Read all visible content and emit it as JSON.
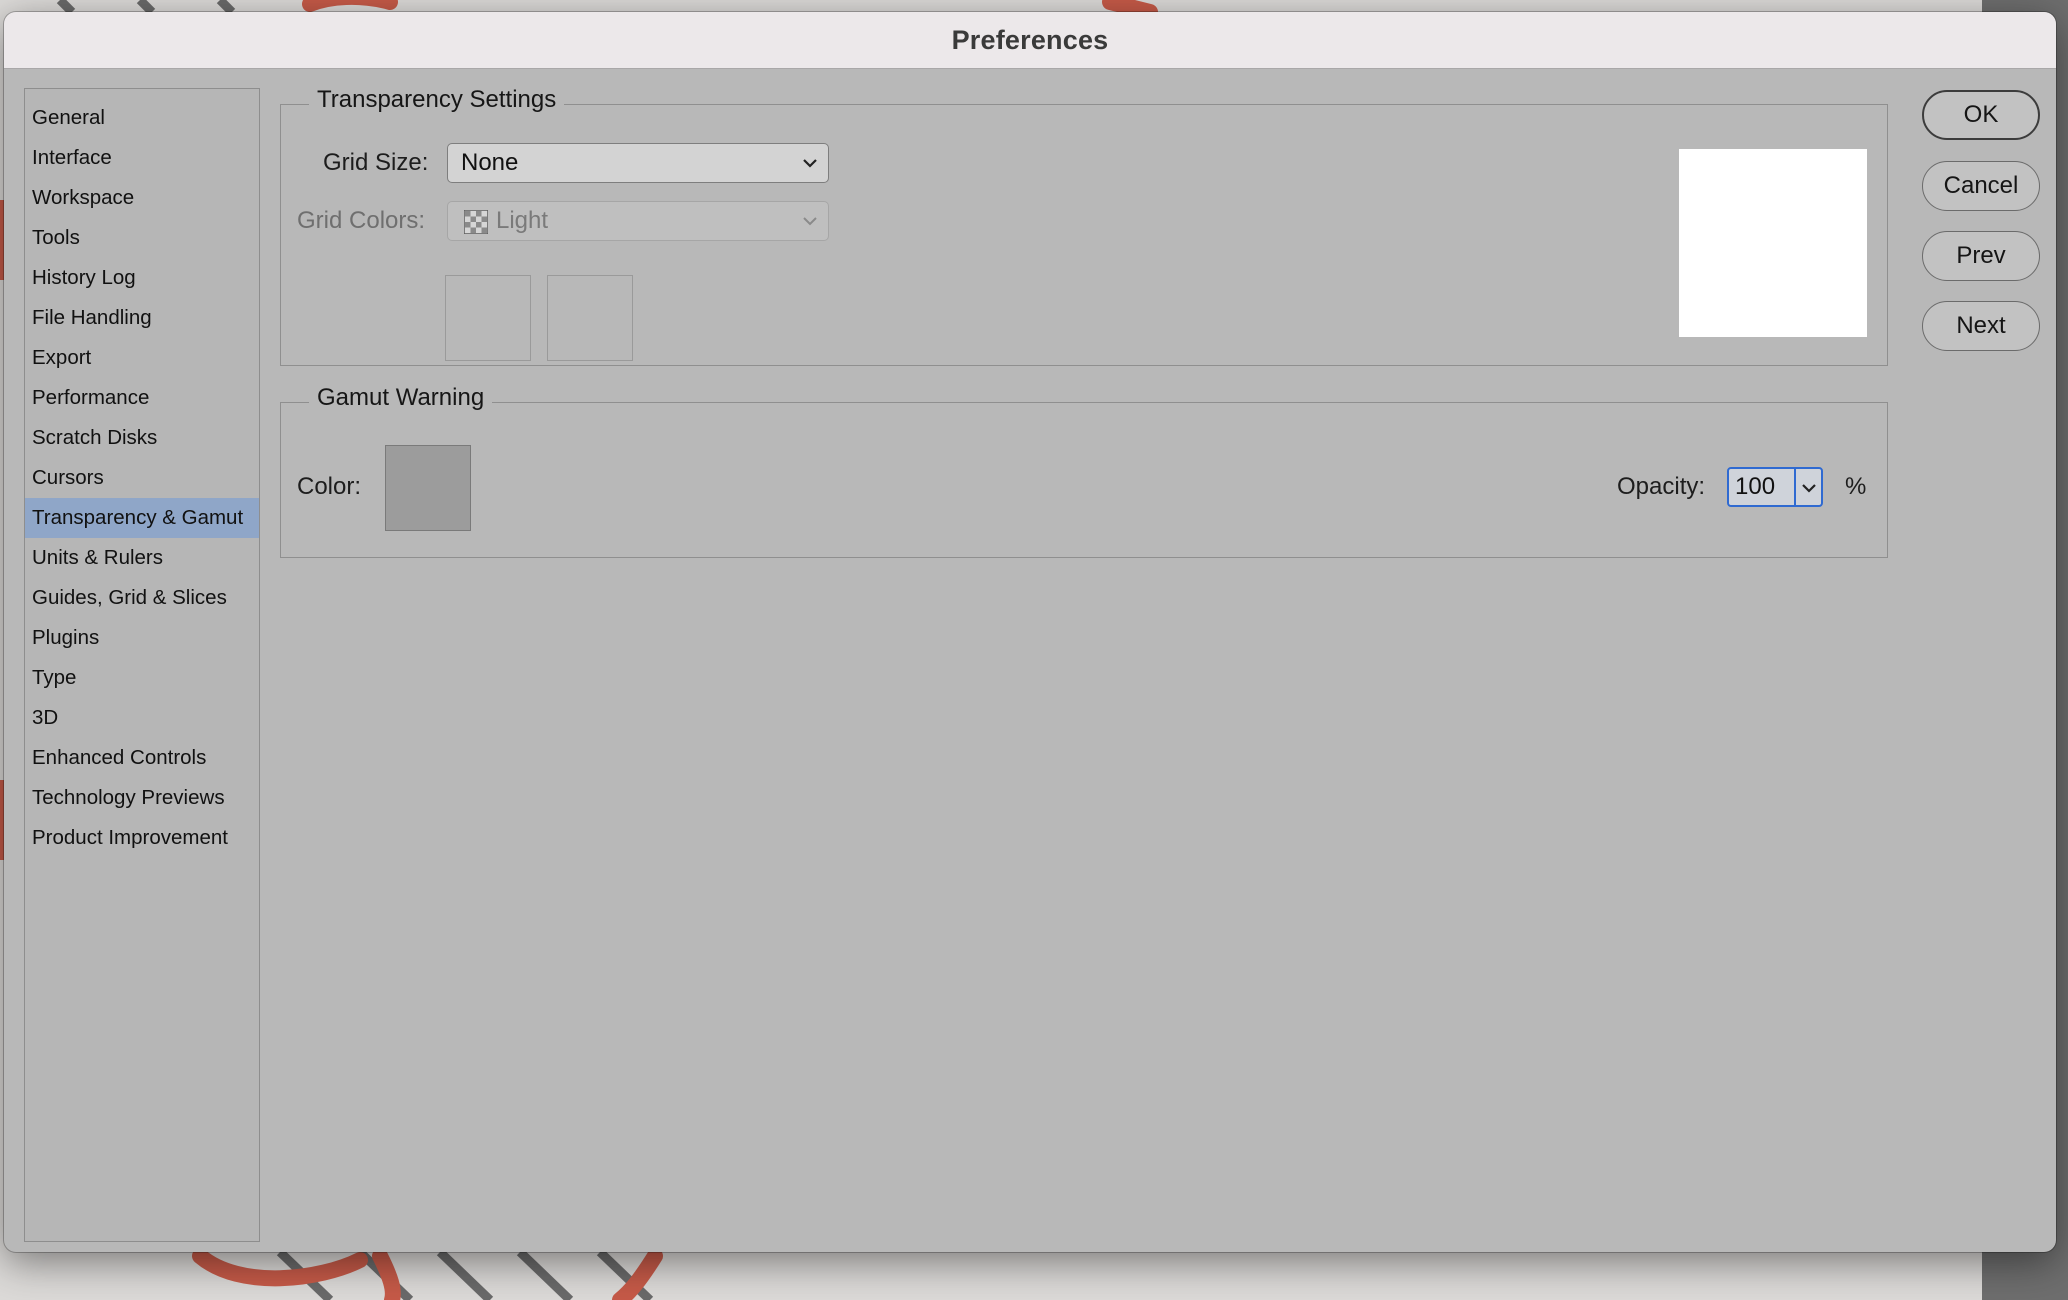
{
  "window": {
    "title": "Preferences"
  },
  "sidebar": {
    "items": [
      {
        "label": "General"
      },
      {
        "label": "Interface"
      },
      {
        "label": "Workspace"
      },
      {
        "label": "Tools"
      },
      {
        "label": "History Log"
      },
      {
        "label": "File Handling"
      },
      {
        "label": "Export"
      },
      {
        "label": "Performance"
      },
      {
        "label": "Scratch Disks"
      },
      {
        "label": "Cursors"
      },
      {
        "label": "Transparency & Gamut",
        "selected": true
      },
      {
        "label": "Units & Rulers"
      },
      {
        "label": "Guides, Grid & Slices"
      },
      {
        "label": "Plugins"
      },
      {
        "label": "Type"
      },
      {
        "label": "3D"
      },
      {
        "label": "Enhanced Controls"
      },
      {
        "label": "Technology Previews"
      },
      {
        "label": "Product Improvement"
      }
    ]
  },
  "transparency": {
    "title": "Transparency Settings",
    "grid_size_label": "Grid Size:",
    "grid_size_value": "None",
    "grid_colors_label": "Grid Colors:",
    "grid_colors_value": "Light",
    "grid_colors_disabled": true
  },
  "gamut": {
    "title": "Gamut Warning",
    "color_label": "Color:",
    "color_value": "#9c9c9c",
    "opacity_label": "Opacity:",
    "opacity_value": "100",
    "opacity_unit": "%"
  },
  "buttons": {
    "ok": "OK",
    "cancel": "Cancel",
    "prev": "Prev",
    "next": "Next"
  },
  "colors": {
    "selection": "#8fa6c8",
    "focus_ring": "#2f6ad1",
    "dialog_bg": "#b8b8b8",
    "titlebar_bg": "#ece8ea"
  }
}
